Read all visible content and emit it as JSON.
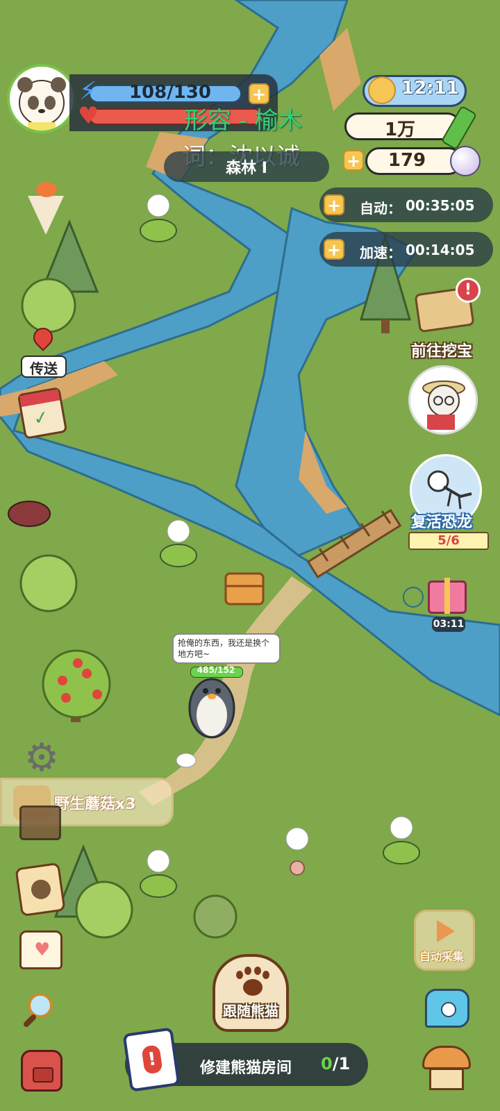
{
  "player": {
    "energy_text": "108/130"
  },
  "lyrics": {
    "line1": "形容 - 榆木",
    "line2": "词：沈以诚"
  },
  "location": {
    "name": "森林 I"
  },
  "status": {
    "time": "12:11",
    "currency_bamboo": "1万",
    "currency_pearl": "179",
    "auto_label": "自动：",
    "auto_time": "00:35:05",
    "speed_label": "加速：",
    "speed_time": "00:14:05"
  },
  "right_menu": {
    "treasure_label": "前往挖宝",
    "revive_label": "复活恐龙",
    "revive_progress": "5/6",
    "gift_timer": "03:11",
    "auto_collect_label": "自动采集"
  },
  "left_menu": {
    "teleport_label": "传送"
  },
  "world": {
    "speech_bubble": "抢俺的东西，我还是换个地方吧~",
    "npc_hp": "485/152",
    "pickup_toast": "野生蘑菇x3"
  },
  "bottom": {
    "follow_label": "跟随熊猫",
    "quest_text": "修建熊猫房间",
    "quest_progress_done": "0",
    "quest_progress_total": "/1"
  },
  "colors": {
    "grass": "#7fa94a",
    "river": "#4d9fc7",
    "energy_bar": "#6fb6f0",
    "health_bar": "#ea5b4e",
    "accent_gold": "#f6c654",
    "quest_done": "#6bd34d"
  }
}
